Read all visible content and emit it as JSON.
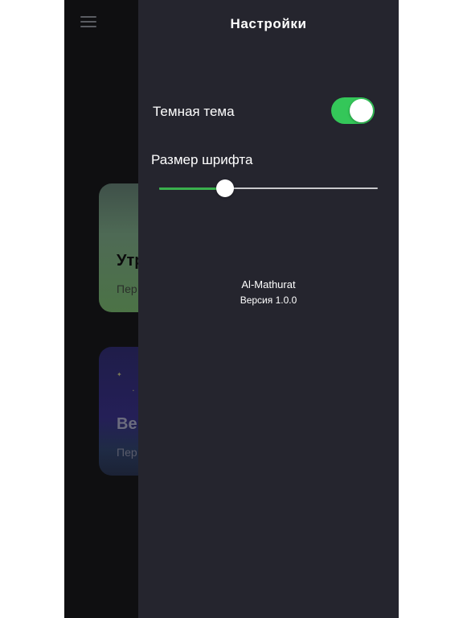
{
  "colors": {
    "panel_bg": "#25252e",
    "page_bg": "#0f0f11",
    "accent_green": "#34c759",
    "slider_fill": "#3ab04d"
  },
  "background": {
    "menu_icon": "hamburger-menu-icon",
    "cards": [
      {
        "title": "Утр",
        "subtitle": "Пер"
      },
      {
        "title": "Ве",
        "subtitle": "Пер"
      }
    ]
  },
  "settings": {
    "title": "Настройки",
    "dark_theme": {
      "label": "Темная тема",
      "enabled": true
    },
    "font_size": {
      "label": "Размер шрифта",
      "value_fraction": 0.3
    },
    "about": {
      "app_name": "Al-Mathurat",
      "version": "Версия 1.0.0"
    }
  }
}
